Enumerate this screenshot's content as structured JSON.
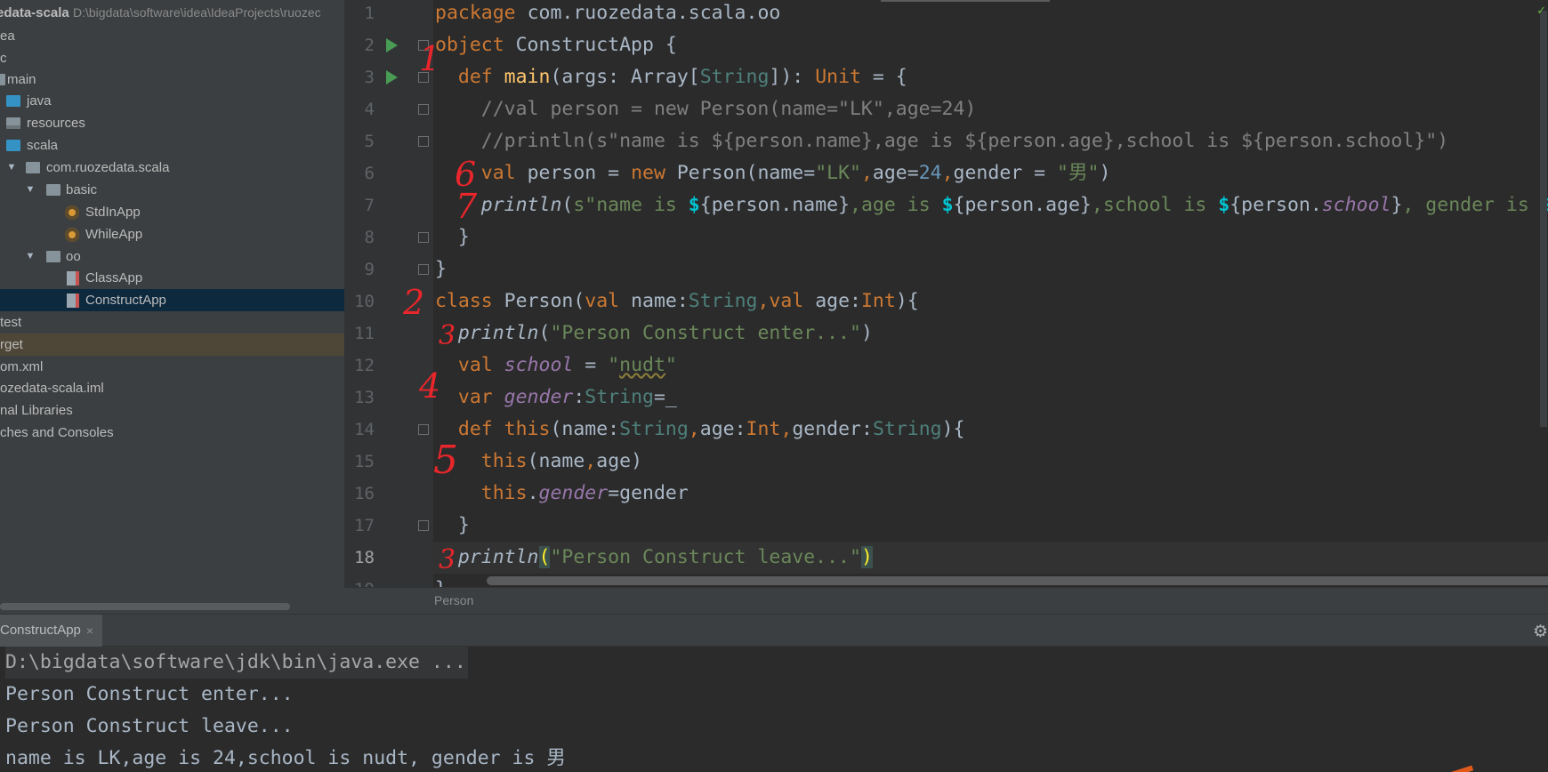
{
  "sidebar": {
    "project_name": "edata-scala",
    "project_path": "D:\\bigdata\\software\\idea\\IdeaProjects\\ruozec",
    "items": [
      {
        "label": "ea"
      },
      {
        "label": "c"
      },
      {
        "label": "main"
      },
      {
        "label": "java"
      },
      {
        "label": "resources"
      },
      {
        "label": "scala"
      },
      {
        "label": "com.ruozedata.scala"
      },
      {
        "label": "basic"
      },
      {
        "label": "StdInApp"
      },
      {
        "label": "WhileApp"
      },
      {
        "label": "oo"
      },
      {
        "label": "ClassApp"
      },
      {
        "label": "ConstructApp"
      },
      {
        "label": "test"
      },
      {
        "label": "rget"
      },
      {
        "label": "om.xml"
      },
      {
        "label": "ozedata-scala.iml"
      },
      {
        "label": "nal Libraries"
      },
      {
        "label": "ches and Consoles"
      }
    ]
  },
  "editor": {
    "current_line": 18,
    "breadcrumb": "Person",
    "line_numbers": [
      "1",
      "2",
      "3",
      "4",
      "5",
      "6",
      "7",
      "8",
      "9",
      "10",
      "11",
      "12",
      "13",
      "14",
      "15",
      "16",
      "17",
      "18",
      "19"
    ],
    "lines": [
      [
        {
          "t": "package ",
          "c": "kw"
        },
        {
          "t": "com.ruozedata.scala.oo"
        }
      ],
      [
        {
          "t": "object ",
          "c": "kw"
        },
        {
          "t": "ConstructApp {"
        }
      ],
      [
        {
          "t": "  def ",
          "c": "kw"
        },
        {
          "t": "main",
          "c": "fn"
        },
        {
          "t": "(args: Array["
        },
        {
          "t": "String",
          "c": "ty"
        },
        {
          "t": "]): "
        },
        {
          "t": "Unit",
          "c": "kw"
        },
        {
          "t": " = {"
        }
      ],
      [
        {
          "t": "    //val person = new Person(name=\"LK\",age=24)",
          "c": "cm"
        }
      ],
      [
        {
          "t": "    //println(s\"name is ${person.name},age is ${person.age},school is ${person.school}\")",
          "c": "cm"
        }
      ],
      [
        {
          "t": "    val ",
          "c": "kw"
        },
        {
          "t": "person = "
        },
        {
          "t": "new ",
          "c": "kw"
        },
        {
          "t": "Person(name="
        },
        {
          "t": "\"LK\"",
          "c": "st"
        },
        {
          "t": ",",
          "c": "kw"
        },
        {
          "t": "age="
        },
        {
          "t": "24",
          "c": "nm"
        },
        {
          "t": ",",
          "c": "kw"
        },
        {
          "t": "gender = "
        },
        {
          "t": "\"男\"",
          "c": "st"
        },
        {
          "t": ")"
        }
      ],
      [
        {
          "t": "    "
        },
        {
          "t": "println",
          "c": "it"
        },
        {
          "t": "("
        },
        {
          "t": "s\"name is ",
          "c": "st"
        },
        {
          "t": "$",
          "c": "dl"
        },
        {
          "t": "{person.name}"
        },
        {
          "t": ",age is ",
          "c": "st"
        },
        {
          "t": "$",
          "c": "dl"
        },
        {
          "t": "{person.age}"
        },
        {
          "t": ",school is ",
          "c": "st"
        },
        {
          "t": "$",
          "c": "dl"
        },
        {
          "t": "{person."
        },
        {
          "t": "school",
          "c": "fld"
        },
        {
          "t": "}"
        },
        {
          "t": ", gender is ",
          "c": "st"
        },
        {
          "t": "$",
          "c": "dl"
        }
      ],
      [
        {
          "t": "  }"
        }
      ],
      [
        {
          "t": "}"
        }
      ],
      [
        {
          "t": "class ",
          "c": "kw"
        },
        {
          "t": "Person("
        },
        {
          "t": "val ",
          "c": "kw"
        },
        {
          "t": "name:"
        },
        {
          "t": "String",
          "c": "ty"
        },
        {
          "t": ",",
          "c": "kw"
        },
        {
          "t": "val ",
          "c": "kw"
        },
        {
          "t": "age:"
        },
        {
          "t": "Int",
          "c": "kw"
        },
        {
          "t": "){"
        }
      ],
      [
        {
          "t": "  "
        },
        {
          "t": "println",
          "c": "it"
        },
        {
          "t": "("
        },
        {
          "t": "\"Person Construct enter...\"",
          "c": "st"
        },
        {
          "t": ")"
        }
      ],
      [
        {
          "t": "  val ",
          "c": "kw"
        },
        {
          "t": "school",
          "c": "fld"
        },
        {
          "t": " = "
        },
        {
          "t": "\"",
          "c": "st"
        },
        {
          "t": "nudt",
          "c": "st warn"
        },
        {
          "t": "\"",
          "c": "st"
        }
      ],
      [
        {
          "t": "  var ",
          "c": "kw"
        },
        {
          "t": "gender",
          "c": "fld"
        },
        {
          "t": ":"
        },
        {
          "t": "String",
          "c": "ty"
        },
        {
          "t": "=_"
        }
      ],
      [
        {
          "t": "  def ",
          "c": "kw"
        },
        {
          "t": "this",
          "c": "kw"
        },
        {
          "t": "(name:"
        },
        {
          "t": "String",
          "c": "ty"
        },
        {
          "t": ",",
          "c": "kw"
        },
        {
          "t": "age:"
        },
        {
          "t": "Int",
          "c": "kw"
        },
        {
          "t": ",",
          "c": "kw"
        },
        {
          "t": "gender:"
        },
        {
          "t": "String",
          "c": "ty"
        },
        {
          "t": "){"
        }
      ],
      [
        {
          "t": "    "
        },
        {
          "t": "this",
          "c": "kw"
        },
        {
          "t": "(name"
        },
        {
          "t": ",",
          "c": "kw"
        },
        {
          "t": "age)"
        }
      ],
      [
        {
          "t": "    "
        },
        {
          "t": "this",
          "c": "kw"
        },
        {
          "t": "."
        },
        {
          "t": "gender",
          "c": "fld"
        },
        {
          "t": "=gender"
        }
      ],
      [
        {
          "t": "  }"
        }
      ],
      [
        {
          "t": "  "
        },
        {
          "t": "println",
          "c": "it"
        },
        {
          "t": "(",
          "c": "brace-hl"
        },
        {
          "t": "\"Person Construct leave...\"",
          "c": "st"
        },
        {
          "t": ")",
          "c": "brace-hl"
        }
      ],
      [
        {
          "t": "}"
        }
      ]
    ],
    "annotations": [
      "1",
      "2",
      "3",
      "4",
      "5",
      "6",
      "7",
      "3"
    ]
  },
  "run_panel": {
    "tab_label": "ConstructApp",
    "close_glyph": "×",
    "gear_glyph": "⚙",
    "output": [
      "D:\\bigdata\\software\\jdk\\bin\\java.exe ...",
      "Person Construct enter...",
      "Person Construct leave...",
      "name is LK,age is 24,school is nudt, gender is 男"
    ]
  },
  "colors": {
    "keyword": "#cc7832",
    "string": "#6a8759",
    "comment": "#808080",
    "number": "#6897bb",
    "annotation_red": "#e8262b",
    "sidebar_bg": "#3c3f41",
    "editor_bg": "#2b2b2b"
  }
}
